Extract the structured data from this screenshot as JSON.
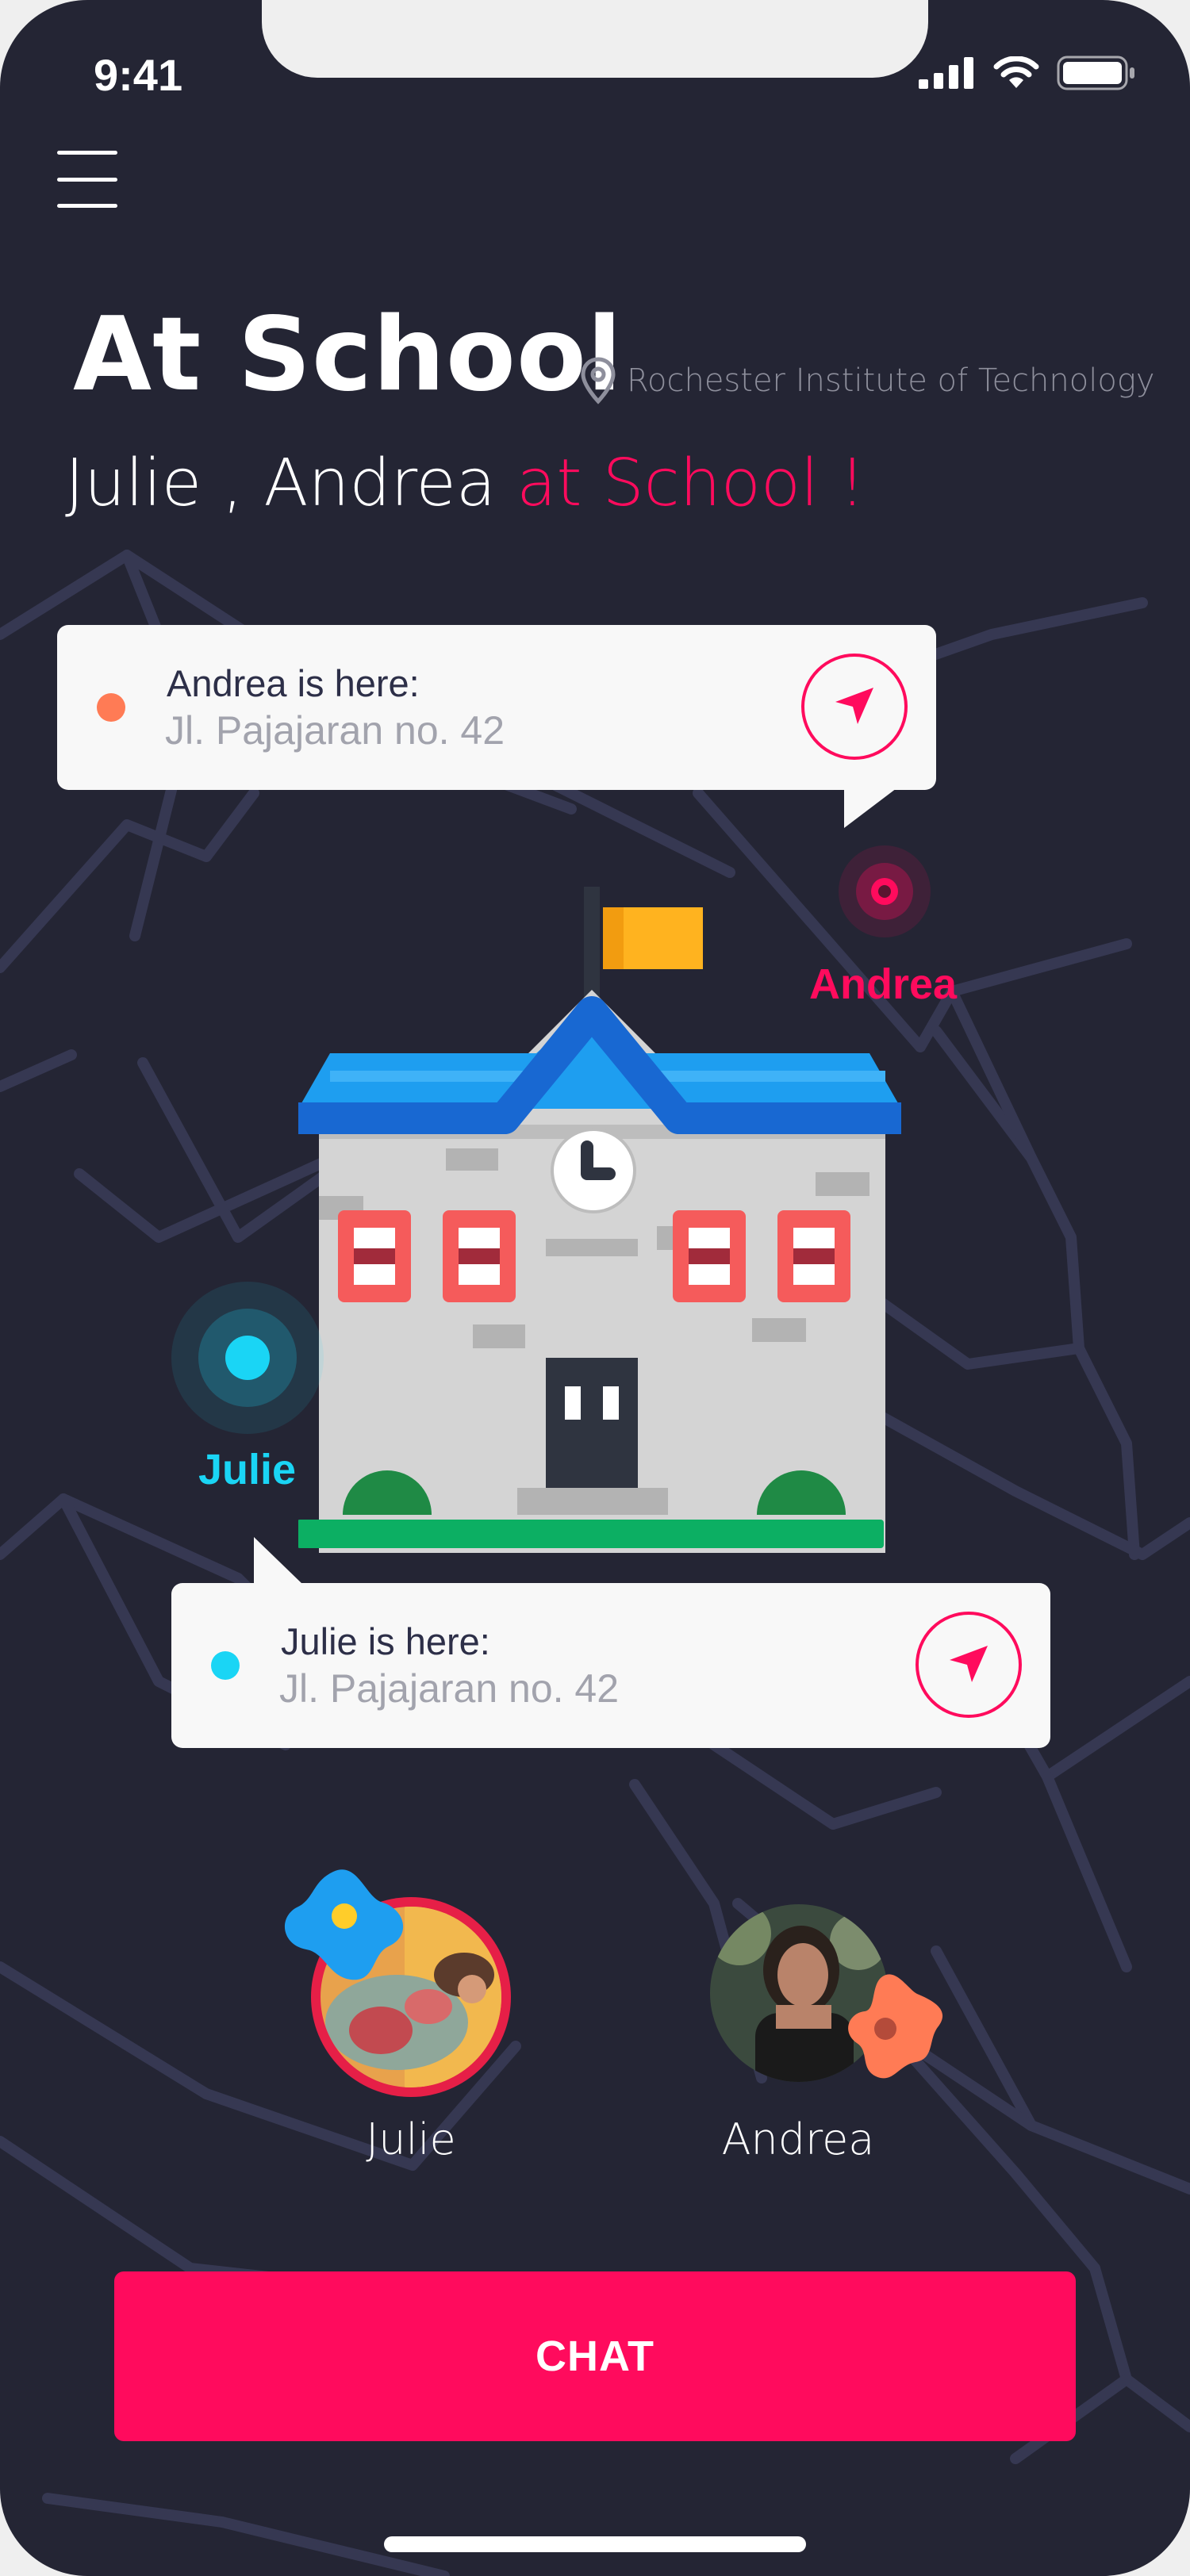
{
  "status_bar": {
    "time": "9:41"
  },
  "header": {
    "title": "At School",
    "location": "Rochester Institute of Technology",
    "subtitle_names": "Julie , Andrea ",
    "subtitle_accent": "at School !"
  },
  "cards": {
    "andrea": {
      "label": "Andrea is here:",
      "address": "Jl. Pajajaran no. 42"
    },
    "julie": {
      "label": "Julie is here:",
      "address": "Jl. Pajajaran no. 42"
    }
  },
  "map_pins": {
    "andrea": "Andrea",
    "julie": "Julie"
  },
  "friends": [
    {
      "name": "Julie"
    },
    {
      "name": "Andrea"
    }
  ],
  "chat_button": "CHAT",
  "colors": {
    "background": "#242534",
    "accent": "#ff0b5d",
    "julie": "#1ad5f5",
    "andrea_dot": "#ff7b55"
  },
  "icons": [
    "menu-icon",
    "location-pin-icon",
    "navigation-arrow-icon",
    "signal-icon",
    "wifi-icon",
    "battery-icon"
  ]
}
